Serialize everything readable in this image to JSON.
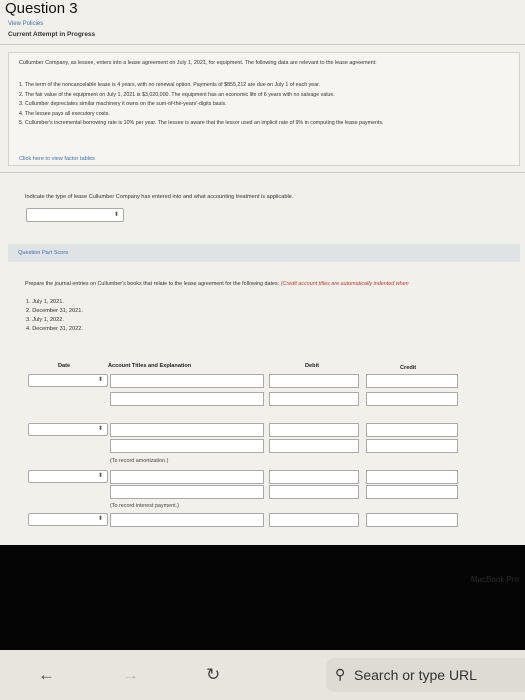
{
  "header": {
    "title": "Question 3",
    "view_policies": "View Policies",
    "current_attempt": "Current Attempt in Progress"
  },
  "problem": {
    "intro": "Cullumber Company, as lessee, enters into a lease agreement on July 1, 2021, for equipment. The following data are relevant to the lease agreement:",
    "facts": [
      "1.  The term of the noncancelable lease is 4 years, with no renewal option. Payments of $855,212 are due on July 1 of each year.",
      "2.  The fair value of the equipment on July 1, 2021 is $3,020,000. The equipment has an economic life of 6 years with no salvage value.",
      "3.  Cullumber depreciates similar machinery it owns on the sum-of-the-years'-digits basis.",
      "4.  The lessee pays all executory costs.",
      "5.  Cullumber's incremental borrowing rate is 10% per year. The lessee is aware that the lessor used an implicit rate of 9% in computing the lease payments."
    ],
    "factor_link": "Click here to view factor tables"
  },
  "part1": {
    "prompt": "Indicate the type of lease Cullumber Company has entered into and what accounting treatment is applicable.",
    "select_value": ""
  },
  "score_bar": {
    "label": "Question Part Score"
  },
  "part2": {
    "prompt": "Prepare the journal entries on Cullumber's books that relate to the lease agreement for the following dates: ",
    "note": "(Credit account titles are automatically indented when",
    "dates": [
      "1.  July 1, 2021.",
      "2.  December 31, 2021.",
      "3.  July 1, 2022.",
      "4.  December 31, 2022."
    ]
  },
  "journal": {
    "headers": {
      "date": "Date",
      "account": "Account Titles and Explanation",
      "debit": "Debit",
      "credit": "Credit"
    },
    "memo_amortization": "(To record amortization.)",
    "memo_interest": "(To record interest payment.)"
  },
  "browser": {
    "back_icon": "back-arrow-icon",
    "forward_icon": "forward-arrow-icon",
    "reload_icon": "reload-icon",
    "search_placeholder": "Search or type URL",
    "watermark": "MacBook Pro"
  }
}
